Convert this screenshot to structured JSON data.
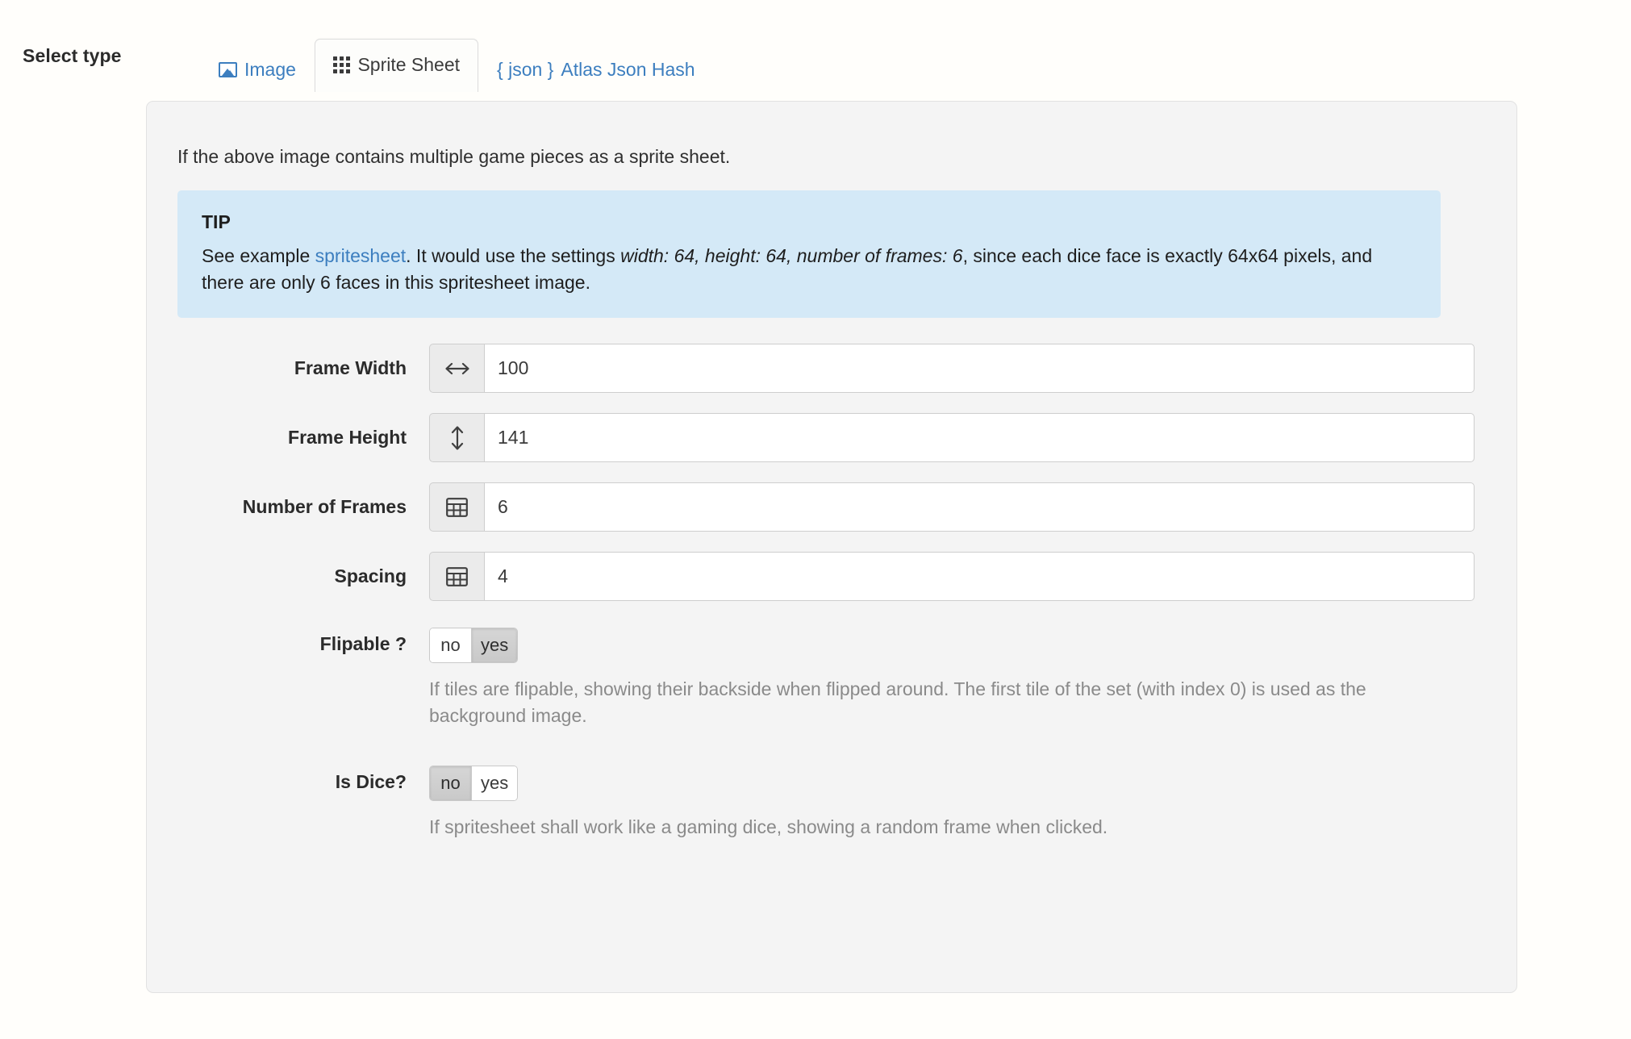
{
  "select_type_label": "Select type",
  "tabs": [
    {
      "label": "Image",
      "icon": "image-icon",
      "active": false
    },
    {
      "label": "Sprite Sheet",
      "icon": "grid-icon",
      "active": true
    },
    {
      "label": "Atlas Json Hash",
      "icon": "json-icon",
      "prefix": "{ json }",
      "active": false
    }
  ],
  "panel": {
    "intro": "If the above image contains multiple game pieces as a sprite sheet.",
    "tip": {
      "title": "TIP",
      "lead": "See example ",
      "link": "spritesheet",
      "mid": ". It would use the settings ",
      "settings": "width: 64, height: 64, number of frames: 6",
      "tail": ", since each dice face is exactly 64x64 pixels, and there are only 6 faces in this spritesheet image."
    },
    "fields": [
      {
        "label": "Frame Width",
        "icon": "arrows-horizontal-icon",
        "value": "100"
      },
      {
        "label": "Frame Height",
        "icon": "arrows-vertical-icon",
        "value": "141"
      },
      {
        "label": "Number of Frames",
        "icon": "table-grid-icon",
        "value": "6"
      },
      {
        "label": "Spacing",
        "icon": "table-grid-icon",
        "value": "4"
      }
    ],
    "toggles": [
      {
        "label": "Flipable ?",
        "options": [
          "no",
          "yes"
        ],
        "selected": "yes",
        "help": "If tiles are flipable, showing their backside when flipped around. The first tile of the set (with index 0) is used as the background image."
      },
      {
        "label": "Is Dice?",
        "options": [
          "no",
          "yes"
        ],
        "selected": "no",
        "help": "If spritesheet shall work like a gaming dice, showing a random frame when clicked."
      }
    ]
  },
  "colors": {
    "link": "#3c7ebf",
    "tip_bg": "#d4e9f7",
    "panel_bg": "#f4f4f4",
    "page_bg": "#fffefb",
    "help_text": "#8a8a8a"
  }
}
